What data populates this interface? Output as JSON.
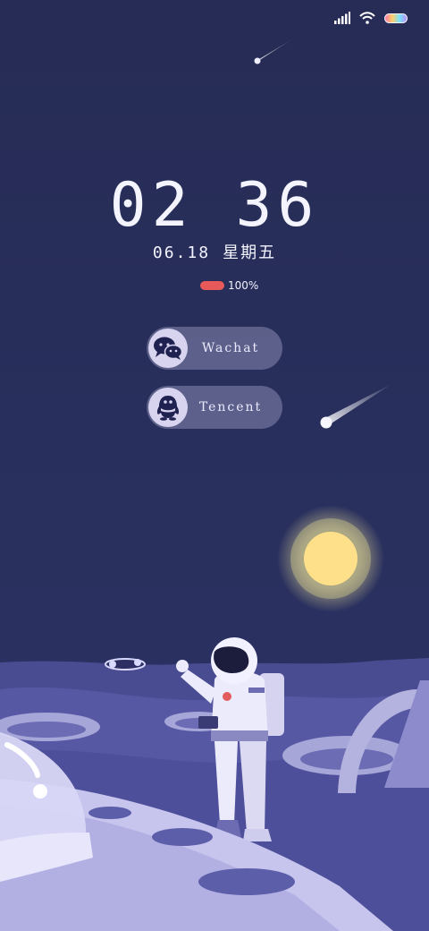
{
  "status_bar": {
    "icons": [
      "signal-icon",
      "wifi-icon",
      "battery-icon"
    ]
  },
  "lockscreen": {
    "time": "02 36",
    "date": "06.18",
    "weekday": "星期五",
    "battery_percent": "100%",
    "battery_level": 1.0,
    "battery_color": "#e85a5a"
  },
  "shortcuts": [
    {
      "label": "Wachat",
      "icon": "wechat-icon"
    },
    {
      "label": "Tencent",
      "icon": "qq-penguin-icon"
    }
  ],
  "colors": {
    "sky": "#27305a",
    "moon": "#ffe08a",
    "ground": "#5a5ba8"
  }
}
